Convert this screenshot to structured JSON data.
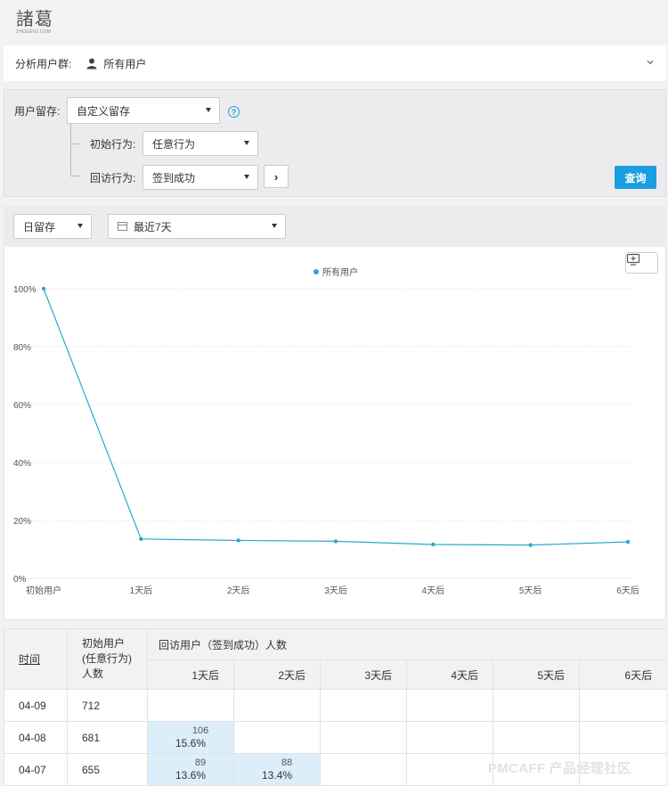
{
  "logo": {
    "main": "諸葛",
    "sub": "ZHUGEIO.COM"
  },
  "segment": {
    "label": "分析用户群:",
    "value": "所有用户"
  },
  "query": {
    "retention_label": "用户留存:",
    "retention_select": "自定义留存",
    "initial_label": "初始行为:",
    "initial_select": "任意行为",
    "return_label": "回访行为:",
    "return_select": "签到成功",
    "query_button": "查询",
    "help_glyph": "?",
    "next_glyph": "›"
  },
  "filters": {
    "period": "日留存",
    "range": "最近7天"
  },
  "chart_data": {
    "type": "line",
    "categories": [
      "初始用户",
      "1天后",
      "2天后",
      "3天后",
      "4天后",
      "5天后",
      "6天后"
    ],
    "series": [
      {
        "name": "所有用户",
        "values": [
          100,
          13.6,
          13.1,
          12.8,
          11.7,
          11.5,
          12.6
        ]
      }
    ],
    "yticks": [
      "0%",
      "20%",
      "40%",
      "60%",
      "80%",
      "100%"
    ],
    "ylim": [
      0,
      100
    ],
    "grid": true,
    "legend": "top-center",
    "color": "#2aa7d0"
  },
  "table": {
    "col_time": "时间",
    "col_initial": [
      "初始用户",
      "(任意行为)",
      "人数"
    ],
    "col_return": "回访用户（签到成功）人数",
    "days": [
      "1天后",
      "2天后",
      "3天后",
      "4天后",
      "5天后",
      "6天后"
    ],
    "rows": [
      {
        "date": "04-09",
        "count": "712",
        "cells": []
      },
      {
        "date": "04-08",
        "count": "681",
        "cells": [
          {
            "num": "106",
            "pct": "15.6%"
          }
        ]
      },
      {
        "date": "04-07",
        "count": "655",
        "cells": [
          {
            "num": "89",
            "pct": "13.6%"
          },
          {
            "num": "88",
            "pct": "13.4%"
          }
        ]
      }
    ]
  },
  "watermark": "PMCAFF 产品经理社区"
}
